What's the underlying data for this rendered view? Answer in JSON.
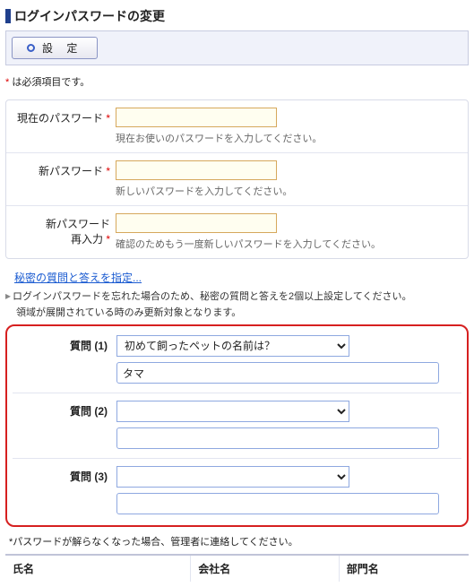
{
  "page": {
    "title": "ログインパスワードの変更"
  },
  "toolbar": {
    "submit_label": "設  定"
  },
  "required_note": "は必須項目です。",
  "fields": {
    "current": {
      "label": "現在のパスワード",
      "hint": "現在お使いのパスワードを入力してください。"
    },
    "newpw": {
      "label": "新パスワード",
      "hint": "新しいパスワードを入力してください。"
    },
    "confirm": {
      "label_l1": "新パスワード",
      "label_l2": "再入力",
      "hint": "確認のためもう一度新しいパスワードを入力してください。"
    }
  },
  "secret": {
    "link": "秘密の質問と答えを指定...",
    "info": "ログインパスワードを忘れた場合のため、秘密の質問と答えを2個以上設定してください。",
    "sub": "領域が展開されている時のみ更新対象となります。"
  },
  "questions": [
    {
      "label": "質問 (1)",
      "selected": "初めて飼ったペットの名前は？",
      "answer": "タマ"
    },
    {
      "label": "質問 (2)",
      "selected": "",
      "answer": ""
    },
    {
      "label": "質問 (3)",
      "selected": "",
      "answer": ""
    }
  ],
  "footnote": "*パスワードが解らなくなった場合、管理者に連絡してください。",
  "table": {
    "col1": "氏名",
    "col2": "会社名",
    "col3": "部門名"
  }
}
